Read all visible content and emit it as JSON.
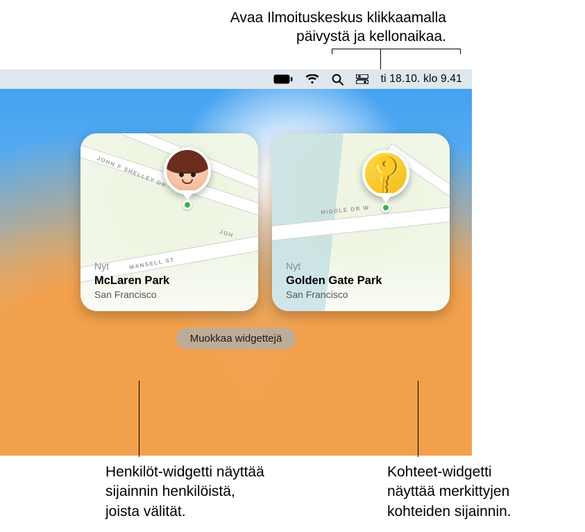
{
  "callouts": {
    "top_l1": "Avaa Ilmoituskeskus klikkaamalla",
    "top_l2": "päivystä ja kellonaikaa.",
    "bottom_left_l1": "Henkilöt-widgetti näyttää",
    "bottom_left_l2": "sijainnin henkilöistä,",
    "bottom_left_l3": "joista välität.",
    "bottom_right_l1": "Kohteet-widgetti",
    "bottom_right_l2": "näyttää merkittyjen",
    "bottom_right_l3": "kohteiden sijainnin."
  },
  "menubar": {
    "datetime": "ti 18.10. klo  9.41"
  },
  "widgets": {
    "people": {
      "ts": "Nyt",
      "place": "McLaren Park",
      "city": "San Francisco",
      "roads": {
        "r1": "JOHN F SHELLEY DR",
        "r2": "JOH",
        "r3": "MANSELL ST"
      }
    },
    "items": {
      "ts": "Nyt",
      "place": "Golden Gate Park",
      "city": "San Francisco",
      "roads": {
        "r1": "MIDDLE DR W"
      }
    }
  },
  "edit_button": "Muokkaa widgettejä"
}
